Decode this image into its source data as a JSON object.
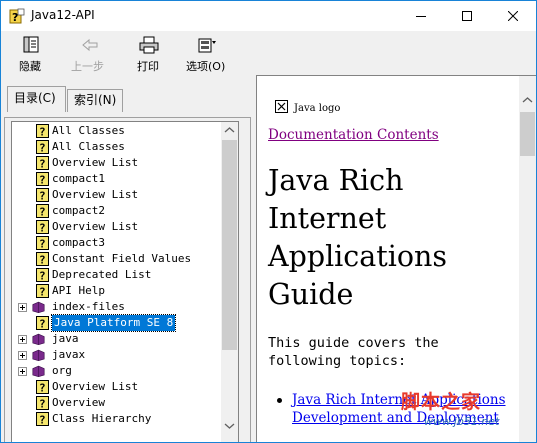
{
  "window": {
    "title": "Java12-API"
  },
  "toolbar": {
    "hide_label": "隐藏",
    "back_label": "上一步",
    "print_label": "打印",
    "options_label": "选项(O)"
  },
  "tabs": {
    "contents_label": "目录(C)",
    "index_label": "索引(N)"
  },
  "tree": {
    "items": [
      {
        "label": "All Classes",
        "icon": "help-page-icon",
        "expander": false
      },
      {
        "label": "All Classes",
        "icon": "help-page-icon",
        "expander": false
      },
      {
        "label": "Overview List",
        "icon": "help-page-icon",
        "expander": false
      },
      {
        "label": "compact1",
        "icon": "help-page-icon",
        "expander": false
      },
      {
        "label": "Overview List",
        "icon": "help-page-icon",
        "expander": false
      },
      {
        "label": "compact2",
        "icon": "help-page-icon",
        "expander": false
      },
      {
        "label": "Overview List",
        "icon": "help-page-icon",
        "expander": false
      },
      {
        "label": "compact3",
        "icon": "help-page-icon",
        "expander": false
      },
      {
        "label": "Constant Field Values",
        "icon": "help-page-icon",
        "expander": false
      },
      {
        "label": "Deprecated List",
        "icon": "help-page-icon",
        "expander": false
      },
      {
        "label": "API Help",
        "icon": "help-page-icon",
        "expander": false
      },
      {
        "label": "index-files",
        "icon": "book-icon",
        "expander": true
      },
      {
        "label": "Java Platform SE 8",
        "icon": "help-page-icon",
        "expander": false,
        "selected": true
      },
      {
        "label": "java",
        "icon": "book-icon",
        "expander": true
      },
      {
        "label": "javax",
        "icon": "book-icon",
        "expander": true
      },
      {
        "label": "org",
        "icon": "book-icon",
        "expander": true
      },
      {
        "label": "Overview List",
        "icon": "help-page-icon",
        "expander": false
      },
      {
        "label": "Overview",
        "icon": "help-page-icon",
        "expander": false
      },
      {
        "label": "Class Hierarchy",
        "icon": "help-page-icon",
        "expander": false
      }
    ]
  },
  "content": {
    "logo_alt": "Java logo",
    "doc_link": "Documentation Contents",
    "title": "Java Rich Internet Applications Guide",
    "intro": "This guide covers the following topics:",
    "bullets": [
      "Java Rich Internet Applications Development and Deployment"
    ]
  },
  "watermark": {
    "text": "脚本之家",
    "url": "www.jb51.net"
  },
  "colors": {
    "selection": "#0078d7",
    "visited_link": "#800080",
    "link": "#0000ee",
    "book_icon": "#7a2a8c"
  }
}
